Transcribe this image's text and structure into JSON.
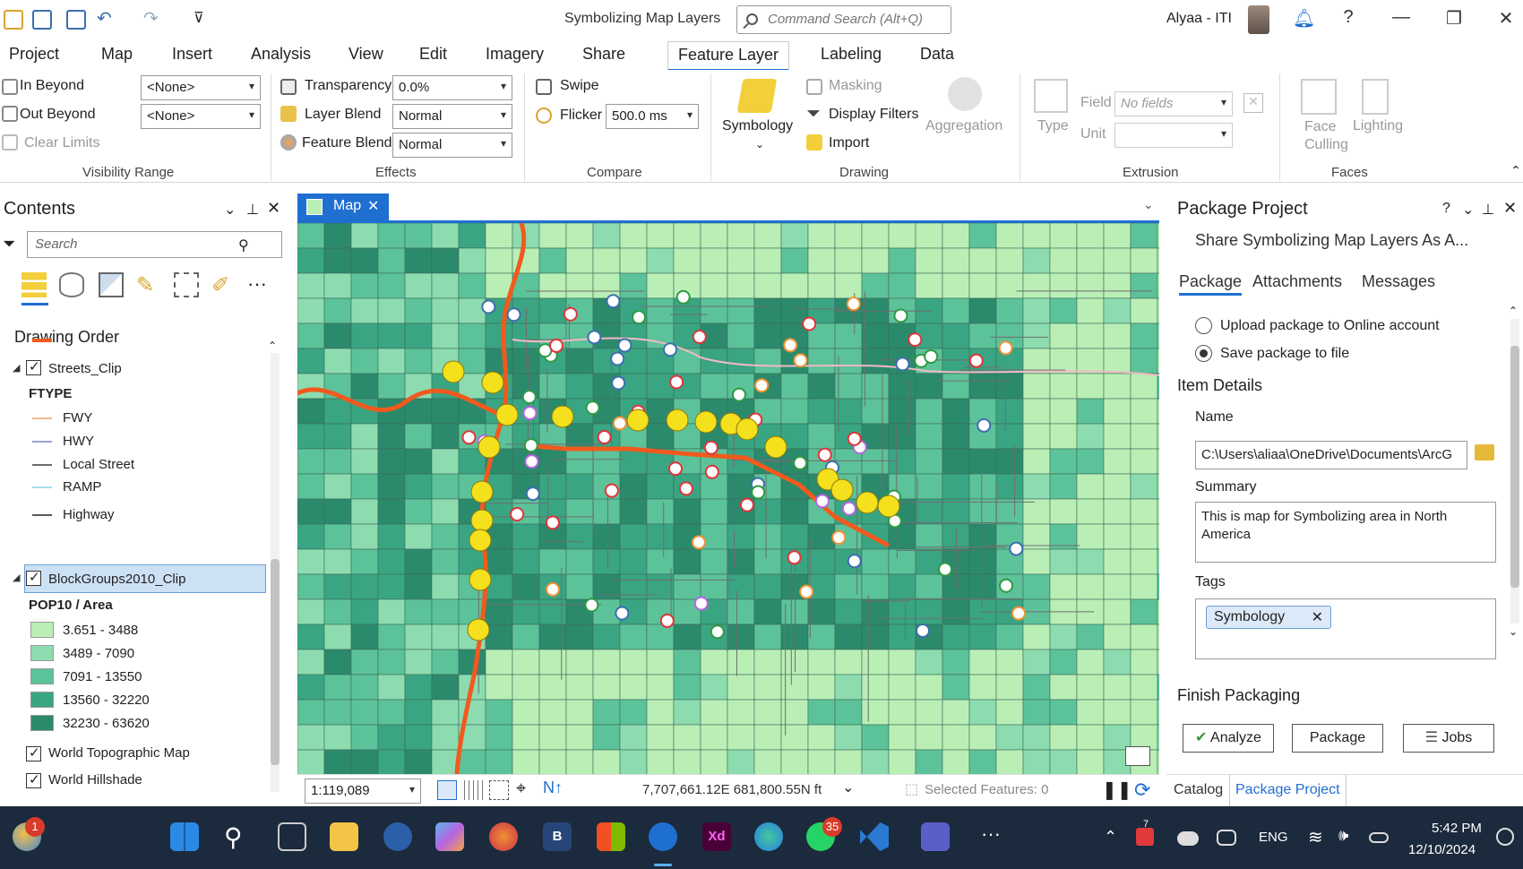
{
  "window": {
    "title": "Symbolizing Map Layers",
    "command_search_placeholder": "Command Search (Alt+Q)",
    "user": "Alyaa - ITI"
  },
  "ribbon_tabs": [
    "Project",
    "Map",
    "Insert",
    "Analysis",
    "View",
    "Edit",
    "Imagery",
    "Share",
    "Feature Layer",
    "Labeling",
    "Data"
  ],
  "ribbon": {
    "visibility_range": {
      "label": "Visibility Range",
      "in_beyond": "In Beyond",
      "out_beyond": "Out Beyond",
      "clear_limits": "Clear Limits",
      "in_value": "<None>",
      "out_value": "<None>"
    },
    "effects": {
      "label": "Effects",
      "transparency": "Transparency",
      "transparency_value": "0.0%",
      "layer_blend": "Layer Blend",
      "layer_blend_value": "Normal",
      "feature_blend": "Feature Blend",
      "feature_blend_value": "Normal"
    },
    "compare": {
      "label": "Compare",
      "swipe": "Swipe",
      "flicker": "Flicker",
      "flicker_value": "500.0  ms"
    },
    "drawing": {
      "label": "Drawing",
      "symbology": "Symbology",
      "masking": "Masking",
      "display_filters": "Display Filters",
      "import": "Import",
      "aggregation": "Aggregation"
    },
    "extrusion": {
      "label": "Extrusion",
      "type": "Type",
      "field": "Field",
      "field_value": "No fields",
      "unit": "Unit"
    },
    "faces": {
      "label": "Faces",
      "face_culling": "Face Culling",
      "lighting": "Lighting"
    }
  },
  "contents": {
    "title": "Contents",
    "search_placeholder": "Search",
    "drawing_order": "Drawing Order",
    "streets_layer": "Streets_Clip",
    "ftype_header": "FTYPE",
    "street_classes": [
      {
        "label": "FWY",
        "color": "#f2b98f"
      },
      {
        "label": "HWY",
        "color": "#9aa3d9"
      },
      {
        "label": "Local Street",
        "color": "#6e6e6e"
      },
      {
        "label": "RAMP",
        "color": "#a8dcf0"
      },
      {
        "label": "Highway",
        "color": "#5a5a5a"
      }
    ],
    "blockgroups_layer": "BlockGroups2010_Clip",
    "pop_header": "POP10 / Area",
    "pop_classes": [
      {
        "label": "3.651 - 3488",
        "color": "#b9efb5"
      },
      {
        "label": "3489 - 7090",
        "color": "#8ddcb0"
      },
      {
        "label": "7091 - 13550",
        "color": "#5cc29a"
      },
      {
        "label": "13560 - 32220",
        "color": "#3aa582"
      },
      {
        "label": "32230 - 63620",
        "color": "#2b8a6c"
      }
    ],
    "basemaps": [
      "World Topographic Map",
      "World Hillshade"
    ]
  },
  "map": {
    "tab_label": "Map",
    "scale": "1:119,089",
    "coordinates": "7,707,661.12E 681,800.55N ft",
    "selected_features": "Selected Features: 0"
  },
  "package": {
    "title": "Package Project",
    "subtitle": "Share Symbolizing Map Layers As A...",
    "tabs": [
      "Package",
      "Attachments",
      "Messages"
    ],
    "upload_option": "Upload package to Online account",
    "save_option": "Save package to file",
    "item_details": "Item Details",
    "name_label": "Name",
    "name_value": "C:\\Users\\aliaa\\OneDrive\\Documents\\ArcG",
    "summary_label": "Summary",
    "summary_value": "This is map for Symbolizing area in North America",
    "tags_label": "Tags",
    "tag": "Symbology",
    "finish": "Finish Packaging",
    "analyze": "Analyze",
    "package_btn": "Package",
    "jobs": "Jobs",
    "bottom_tabs": [
      "Catalog",
      "Package Project"
    ]
  },
  "taskbar": {
    "weather_badge": "1",
    "whatsapp_badge": "35",
    "language": "ENG",
    "time": "5:42 PM",
    "date": "12/10/2024",
    "calendar_badge": "7"
  },
  "colors": {
    "accent": "#1f6fd1",
    "route": "#f05a1e",
    "stop": "#f4e01c"
  }
}
